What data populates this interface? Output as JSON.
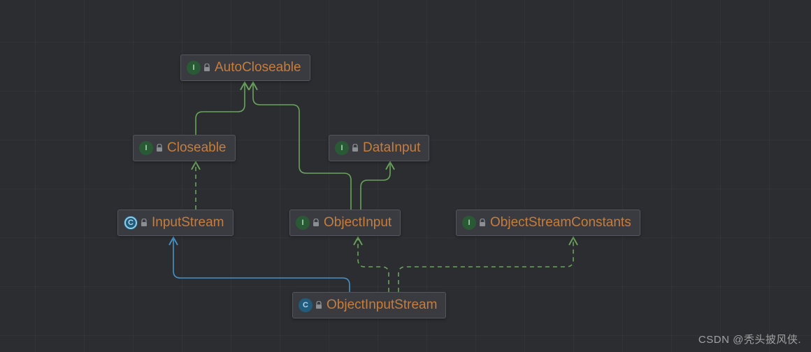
{
  "nodes": {
    "autoCloseable": {
      "label": "AutoCloseable",
      "kind": "interface"
    },
    "closeable": {
      "label": "Closeable",
      "kind": "interface"
    },
    "dataInput": {
      "label": "DataInput",
      "kind": "interface"
    },
    "inputStream": {
      "label": "InputStream",
      "kind": "abstract"
    },
    "objectInput": {
      "label": "ObjectInput",
      "kind": "interface"
    },
    "objectStreamConstants": {
      "label": "ObjectStreamConstants",
      "kind": "interface"
    },
    "objectInputStream": {
      "label": "ObjectInputStream",
      "kind": "class"
    }
  },
  "edges": [
    {
      "from": "closeable",
      "to": "autoCloseable",
      "style": "solid",
      "color": "green"
    },
    {
      "from": "inputStream",
      "to": "closeable",
      "style": "dashed",
      "color": "green"
    },
    {
      "from": "objectInput",
      "to": "autoCloseable",
      "style": "solid",
      "color": "green"
    },
    {
      "from": "objectInput",
      "to": "dataInput",
      "style": "solid",
      "color": "green"
    },
    {
      "from": "objectInputStream",
      "to": "inputStream",
      "style": "solid",
      "color": "blue"
    },
    {
      "from": "objectInputStream",
      "to": "objectInput",
      "style": "dashed",
      "color": "green"
    },
    {
      "from": "objectInputStream",
      "to": "objectStreamConstants",
      "style": "dashed",
      "color": "green"
    }
  ],
  "colors": {
    "green": "#6ba35d",
    "blue": "#4a90c2"
  },
  "watermark": "CSDN @秃头披风侠."
}
